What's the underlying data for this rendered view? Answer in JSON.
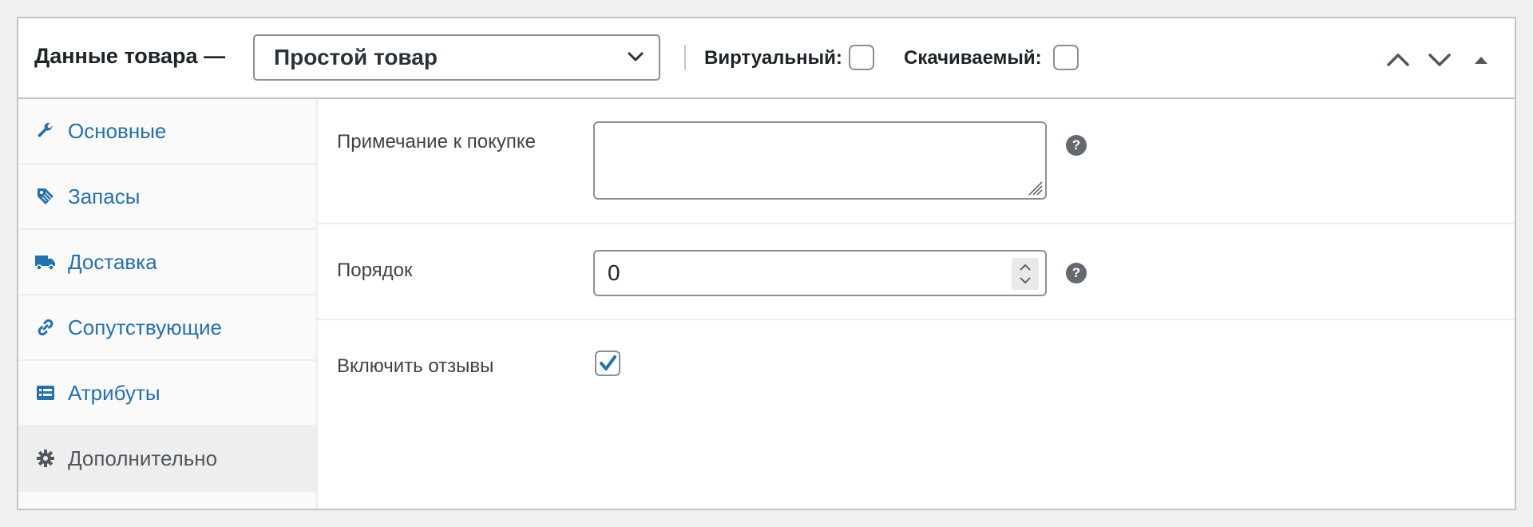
{
  "header": {
    "title": "Данные товара —",
    "product_type": "Простой товар",
    "virtual_label": "Виртуальный:",
    "virtual_checked": false,
    "downloadable_label": "Скачиваемый:",
    "downloadable_checked": false
  },
  "tabs": [
    {
      "label": "Основные",
      "icon": "wrench-icon"
    },
    {
      "label": "Запасы",
      "icon": "tag-icon"
    },
    {
      "label": "Доставка",
      "icon": "truck-icon"
    },
    {
      "label": "Сопутствующие",
      "icon": "link-icon"
    },
    {
      "label": "Атрибуты",
      "icon": "list-icon"
    },
    {
      "label": "Дополнительно",
      "icon": "gear-icon",
      "active": true
    }
  ],
  "fields": {
    "purchase_note": {
      "label": "Примечание к покупке",
      "value": ""
    },
    "menu_order": {
      "label": "Порядок",
      "value": "0"
    },
    "enable_reviews": {
      "label": "Включить отзывы",
      "checked": true
    }
  },
  "colors": {
    "link": "#2271b1",
    "active_tab_bg": "#eeeeee",
    "border": "#c3c4c7"
  }
}
